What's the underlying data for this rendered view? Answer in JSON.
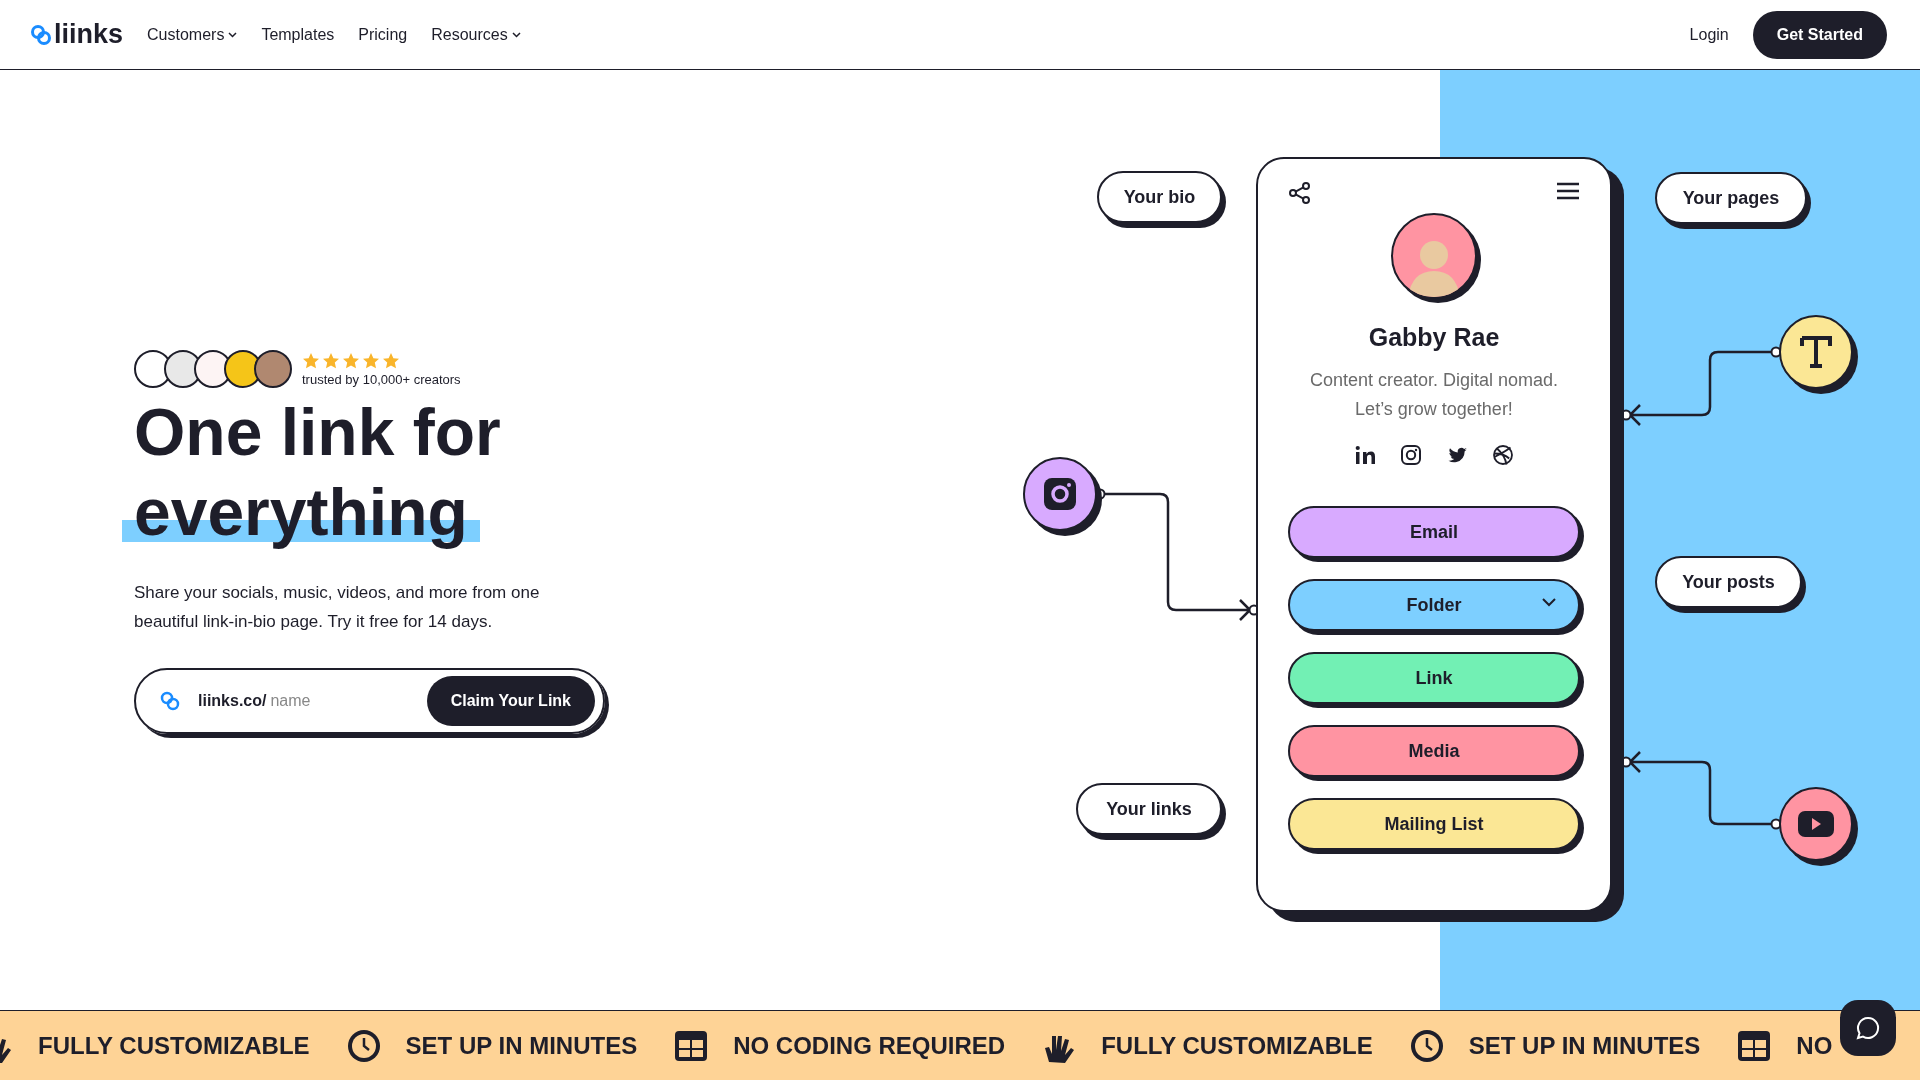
{
  "nav": {
    "logo": "liinks",
    "menu": [
      {
        "label": "Customers",
        "dropdown": true
      },
      {
        "label": "Templates",
        "dropdown": false
      },
      {
        "label": "Pricing",
        "dropdown": false
      },
      {
        "label": "Resources",
        "dropdown": true
      }
    ],
    "login": "Login",
    "cta": "Get Started"
  },
  "hero": {
    "trust": {
      "avatars": [
        {
          "color": "#ffffff"
        },
        {
          "color": "#e8e8e8"
        },
        {
          "color": "#fdf4f4"
        },
        {
          "color": "#f5c518"
        },
        {
          "color": "#b08870"
        }
      ],
      "stars": 5,
      "caption": "trusted by 10,000+ creators"
    },
    "headline": [
      {
        "text": "One link for",
        "highlighted": false
      },
      {
        "text": "everything",
        "highlighted": true
      }
    ],
    "description": "Share your socials, music, videos, and more from one beautiful link-in-bio page. Try it free for 14 days.",
    "claim": {
      "prefix": "liinks.co/",
      "placeholder": "name",
      "button": "Claim Your Link"
    }
  },
  "profile": {
    "name": "Gabby Rae",
    "bio": "Content creator. Digital nomad. Let’s grow together!",
    "socials": [
      {
        "kind": "linkedin"
      },
      {
        "kind": "instagram"
      },
      {
        "kind": "twitter"
      },
      {
        "kind": "dribbble"
      }
    ],
    "links": [
      {
        "label": "Email",
        "kind": "link",
        "color": "#d8aaff"
      },
      {
        "label": "Folder",
        "kind": "folder",
        "color": "#7dcfff"
      },
      {
        "label": "Link",
        "kind": "link",
        "color": "#72f0b4"
      },
      {
        "label": "Media",
        "kind": "link",
        "color": "#ff94a2"
      },
      {
        "label": "Mailing List",
        "kind": "link",
        "color": "#fbe795"
      }
    ]
  },
  "bubbles": [
    {
      "text": "Your bio"
    },
    {
      "text": "Your pages"
    },
    {
      "text": "Your posts"
    },
    {
      "text": "Your links"
    }
  ],
  "badges": [
    {
      "kind": "instagram",
      "color": "#d8aaff"
    },
    {
      "kind": "text",
      "color": "#fbe795"
    },
    {
      "kind": "youtube",
      "color": "#ff94a2"
    }
  ],
  "marquee": [
    {
      "kind": "hand",
      "text": "FULLY CUSTOMIZABLE"
    },
    {
      "kind": "clock",
      "text": "SET UP IN MINUTES"
    },
    {
      "kind": "grid",
      "text": "NO CODING REQUIRED"
    },
    {
      "kind": "hand",
      "text": "FULLY CUSTOMIZABLE"
    },
    {
      "kind": "clock",
      "text": "SET UP IN MINUTES"
    },
    {
      "kind": "grid",
      "text": "NO"
    }
  ]
}
